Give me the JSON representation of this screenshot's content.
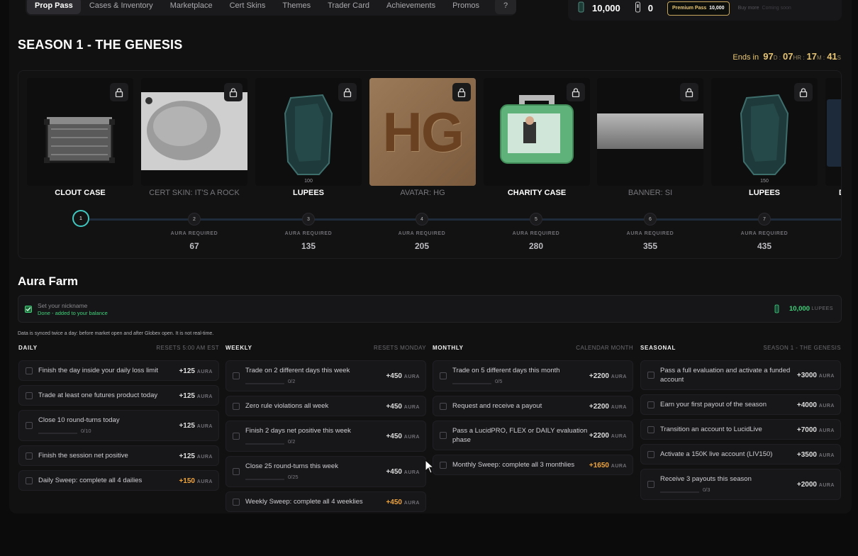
{
  "nav": {
    "tabs": [
      "Prop Pass",
      "Cases & Inventory",
      "Marketplace",
      "Cert Skins",
      "Themes",
      "Trader Card",
      "Achievements",
      "Promos"
    ],
    "help": "?"
  },
  "wallet": {
    "lupees": "10,000",
    "keys": "0",
    "premium_label": "Premium Pass",
    "premium_price": "10,000",
    "buy_more": "Buy more",
    "coming_soon": "Coming soon"
  },
  "season": {
    "title": "SEASON 1 - THE GENESIS",
    "ends_label": "Ends in",
    "days": "97",
    "d": "D :",
    "hours": "07",
    "hr": "HR :",
    "minutes": "17",
    "m": "M :",
    "seconds": "41",
    "s": "S"
  },
  "rewards": [
    {
      "name": "CLOUT CASE",
      "icon": "case-icon",
      "sub": ""
    },
    {
      "name": "CERT SKIN: IT'S A ROCK",
      "icon": "rock-icon",
      "sub": ""
    },
    {
      "name": "LUPEES",
      "icon": "lupee-gem-icon",
      "sub": "100"
    },
    {
      "name": "AVATAR: HG",
      "icon": "avatar-icon",
      "art": "HG",
      "sub": ""
    },
    {
      "name": "CHARITY CASE",
      "icon": "charity-case-icon",
      "sub": ""
    },
    {
      "name": "BANNER: SI",
      "icon": "banner-icon",
      "sub": ""
    },
    {
      "name": "LUPEES",
      "icon": "lupee-gem-icon",
      "sub": "150"
    },
    {
      "name": "D",
      "icon": "partial-icon",
      "sub": ""
    }
  ],
  "levels": [
    {
      "num": "1",
      "aura": ""
    },
    {
      "num": "2",
      "aura": "67"
    },
    {
      "num": "3",
      "aura": "135"
    },
    {
      "num": "4",
      "aura": "205"
    },
    {
      "num": "5",
      "aura": "280"
    },
    {
      "num": "6",
      "aura": "355"
    },
    {
      "num": "7",
      "aura": "435"
    }
  ],
  "aura_required_label": "AURA REQUIRED",
  "aura_farm": {
    "title": "Aura Farm",
    "nick_title": "Set your nickname",
    "nick_status": "Done - added to your balance",
    "nick_reward": "10,000",
    "nick_unit": "LUPEES",
    "sync_note": "Data is synced twice a day: before market open and after Globex open. It is not real-time."
  },
  "aura_unit": "AURA",
  "columns": [
    {
      "title": "DAILY",
      "reset": "RESETS 5:00 AM EST",
      "quests": [
        {
          "text": "Finish the day inside your daily loss limit",
          "pts": "+125",
          "gold": false,
          "prog": ""
        },
        {
          "text": "Trade at least one futures product today",
          "pts": "+125",
          "gold": false,
          "prog": ""
        },
        {
          "text": "Close 10 round-turns today",
          "pts": "+125",
          "gold": false,
          "prog": "0/10"
        },
        {
          "text": "Finish the session net positive",
          "pts": "+125",
          "gold": false,
          "prog": ""
        },
        {
          "text": "Daily Sweep: complete all 4 dailies",
          "pts": "+150",
          "gold": true,
          "prog": ""
        }
      ]
    },
    {
      "title": "WEEKLY",
      "reset": "RESETS MONDAY",
      "quests": [
        {
          "text": "Trade on 2 different days this week",
          "pts": "+450",
          "gold": false,
          "prog": "0/2"
        },
        {
          "text": "Zero rule violations all week",
          "pts": "+450",
          "gold": false,
          "prog": ""
        },
        {
          "text": "Finish 2 days net positive this week",
          "pts": "+450",
          "gold": false,
          "prog": "0/2"
        },
        {
          "text": "Close 25 round-turns this week",
          "pts": "+450",
          "gold": false,
          "prog": "0/25"
        },
        {
          "text": "Weekly Sweep: complete all 4 weeklies",
          "pts": "+450",
          "gold": true,
          "prog": ""
        }
      ]
    },
    {
      "title": "MONTHLY",
      "reset": "CALENDAR MONTH",
      "quests": [
        {
          "text": "Trade on 5 different days this month",
          "pts": "+2200",
          "gold": false,
          "prog": "0/5"
        },
        {
          "text": "Request and receive a payout",
          "pts": "+2200",
          "gold": false,
          "prog": ""
        },
        {
          "text": "Pass a LucidPRO, FLEX or DAILY evaluation phase",
          "pts": "+2200",
          "gold": false,
          "prog": ""
        },
        {
          "text": "Monthly Sweep: complete all 3 monthlies",
          "pts": "+1650",
          "gold": true,
          "prog": ""
        }
      ]
    },
    {
      "title": "SEASONAL",
      "reset": "SEASON 1 - THE GENESIS",
      "quests": [
        {
          "text": "Pass a full evaluation and activate a funded account",
          "pts": "+3000",
          "gold": false,
          "prog": ""
        },
        {
          "text": "Earn your first payout of the season",
          "pts": "+4000",
          "gold": false,
          "prog": ""
        },
        {
          "text": "Transition an account to LucidLive",
          "pts": "+7000",
          "gold": false,
          "prog": ""
        },
        {
          "text": "Activate a 150K live account (LIV150)",
          "pts": "+3500",
          "gold": false,
          "prog": ""
        },
        {
          "text": "Receive 3 payouts this season",
          "pts": "+2000",
          "gold": false,
          "prog": "0/3"
        }
      ]
    }
  ]
}
